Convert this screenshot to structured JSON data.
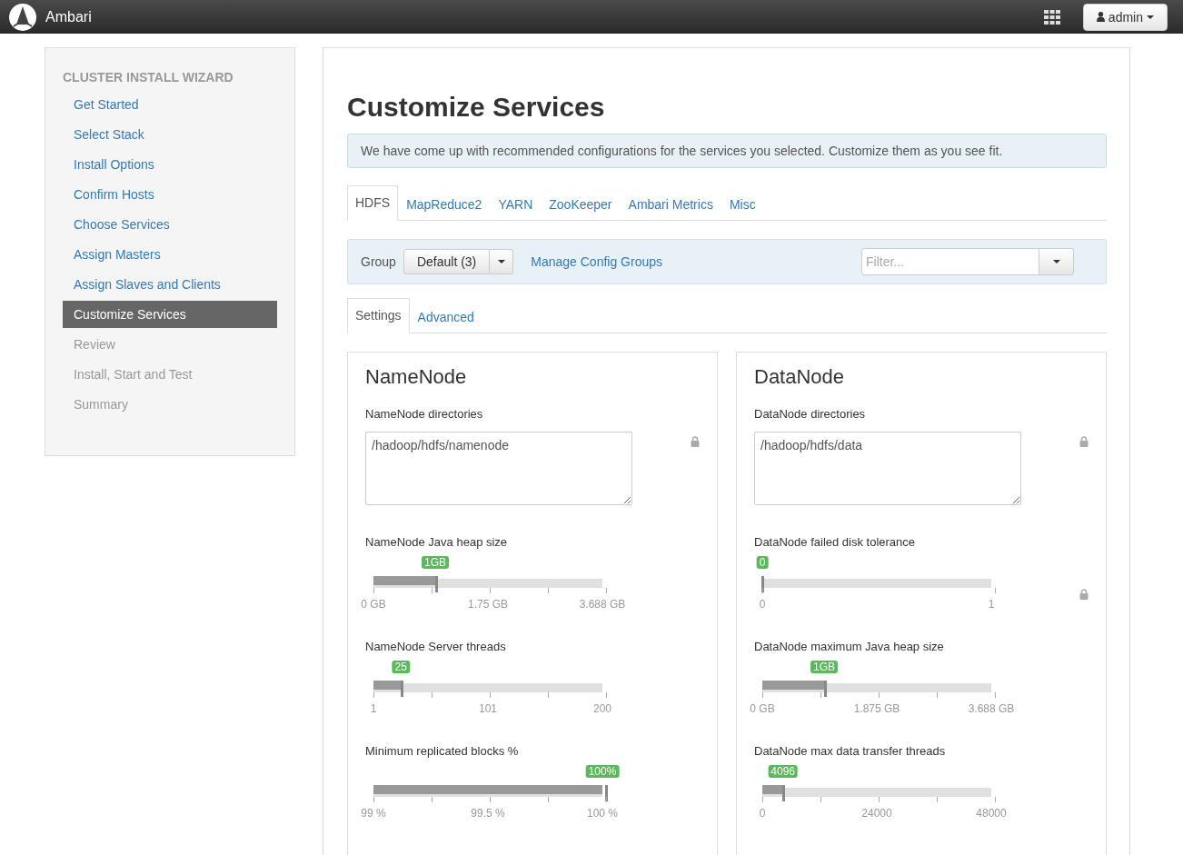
{
  "navbar": {
    "brand": "Ambari",
    "user": "admin"
  },
  "sidebar": {
    "title": "CLUSTER INSTALL WIZARD",
    "items": [
      {
        "label": "Get Started",
        "selected": false,
        "disabled": false
      },
      {
        "label": "Select Stack",
        "selected": false,
        "disabled": false
      },
      {
        "label": "Install Options",
        "selected": false,
        "disabled": false
      },
      {
        "label": "Confirm Hosts",
        "selected": false,
        "disabled": false
      },
      {
        "label": "Choose Services",
        "selected": false,
        "disabled": false
      },
      {
        "label": "Assign Masters",
        "selected": false,
        "disabled": false
      },
      {
        "label": "Assign Slaves and Clients",
        "selected": false,
        "disabled": false
      },
      {
        "label": "Customize Services",
        "selected": true,
        "disabled": false
      },
      {
        "label": "Review",
        "selected": false,
        "disabled": true
      },
      {
        "label": "Install, Start and Test",
        "selected": false,
        "disabled": true
      },
      {
        "label": "Summary",
        "selected": false,
        "disabled": true
      }
    ]
  },
  "page": {
    "title": "Customize Services",
    "info": "We have come up with recommended configurations for the services you selected. Customize them as you see fit."
  },
  "service_tabs": [
    {
      "label": "HDFS",
      "selected": true
    },
    {
      "label": "MapReduce2",
      "selected": false
    },
    {
      "label": "YARN",
      "selected": false
    },
    {
      "label": "ZooKeeper",
      "selected": false
    },
    {
      "label": "Ambari Metrics",
      "selected": false
    },
    {
      "label": "Misc",
      "selected": false
    }
  ],
  "group_bar": {
    "label": "Group",
    "group": "Default (3)",
    "manage_link": "Manage Config Groups",
    "filter_placeholder": "Filter..."
  },
  "sub_tabs": [
    {
      "label": "Settings",
      "selected": true
    },
    {
      "label": "Advanced",
      "selected": false
    }
  ],
  "sections": [
    {
      "title": "NameNode",
      "configs": [
        {
          "kind": "textarea",
          "label": "NameNode directories",
          "value": "/hadoop/hdfs/namenode",
          "locked": true
        },
        {
          "kind": "slider",
          "label": "NameNode Java heap size",
          "reading": "1GB",
          "level": 0.27,
          "ticks": [
            "0 GB",
            "1.75 GB",
            "3.688 GB"
          ],
          "locked": false
        },
        {
          "kind": "slider",
          "label": "NameNode Server threads",
          "reading": "25",
          "level": 0.12,
          "ticks": [
            "1",
            "101",
            "200"
          ],
          "locked": false
        },
        {
          "kind": "slider",
          "label": "Minimum replicated blocks %",
          "reading": "100%",
          "level": 1,
          "ticks": [
            "99 %",
            "99.5 %",
            "100 %"
          ],
          "locked": false
        }
      ]
    },
    {
      "title": "DataNode",
      "configs": [
        {
          "kind": "textarea",
          "label": "DataNode directories",
          "value": "/hadoop/hdfs/data",
          "locked": true
        },
        {
          "kind": "slider",
          "label": "DataNode failed disk tolerance",
          "reading": "0",
          "level": 0,
          "ticks": [
            "0",
            "1"
          ],
          "locked": true
        },
        {
          "kind": "slider",
          "label": "DataNode maximum Java heap size",
          "reading": "1GB",
          "level": 0.27,
          "ticks": [
            "0 GB",
            "1.875 GB",
            "3.688 GB"
          ],
          "locked": false
        },
        {
          "kind": "slider",
          "label": "DataNode max data transfer threads",
          "reading": "4096",
          "level": 0.09,
          "ticks": [
            "0",
            "24000",
            "48000"
          ],
          "locked": false
        }
      ]
    }
  ]
}
